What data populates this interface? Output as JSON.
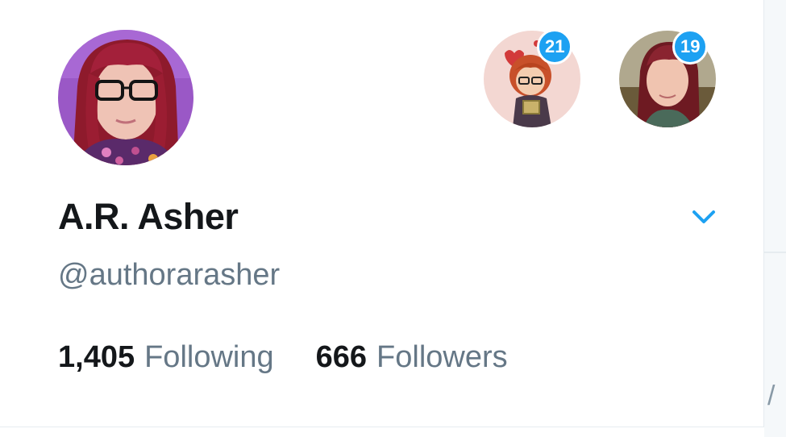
{
  "profile": {
    "display_name": "A.R. Asher",
    "handle": "@authorarasher",
    "avatar_icon": "profile-photo"
  },
  "accounts": [
    {
      "avatar_icon": "cartoon-avatar",
      "badge": "21"
    },
    {
      "avatar_icon": "profile-photo",
      "badge": "19"
    }
  ],
  "menu_icon": "chevron-down-icon",
  "stats": {
    "following_count": "1,405",
    "following_label": "Following",
    "followers_count": "666",
    "followers_label": "Followers"
  },
  "colors": {
    "accent": "#1da1f2",
    "text_primary": "#14171a",
    "text_secondary": "#657786"
  }
}
